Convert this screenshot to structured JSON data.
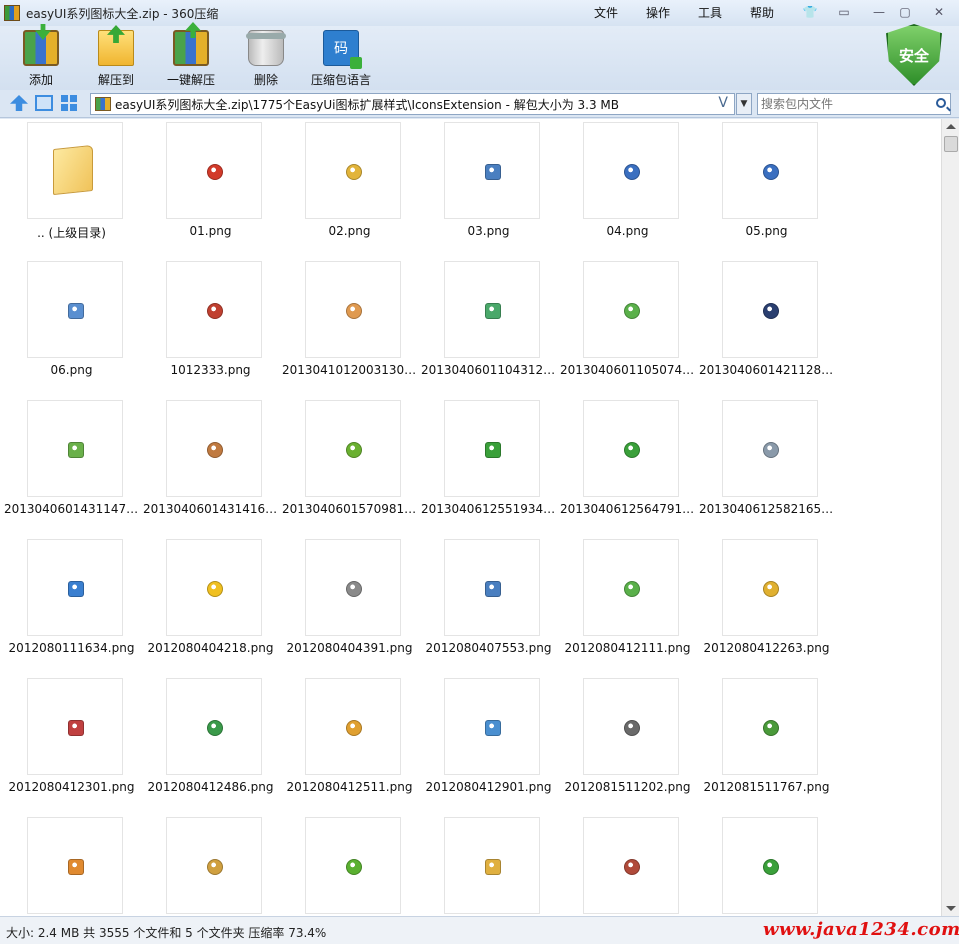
{
  "window": {
    "title": "easyUI系列图标大全.zip - 360压缩",
    "menus": [
      "文件",
      "操作",
      "工具",
      "帮助"
    ]
  },
  "toolbar": {
    "tools": [
      {
        "label": "添加",
        "icon": "add-archive-icon"
      },
      {
        "label": "解压到",
        "icon": "extract-to-icon"
      },
      {
        "label": "一键解压",
        "icon": "one-click-extract-icon"
      },
      {
        "label": "删除",
        "icon": "trash-icon"
      },
      {
        "label": "压缩包语言",
        "icon": "archive-language-icon",
        "glyph": "码"
      }
    ],
    "security_badge": "安全"
  },
  "address": {
    "path": "easyUI系列图标大全.zip\\1775个EasyUi图标扩展样式\\IconsExtension - 解包大小为 3.3 MB",
    "search_placeholder": "搜索包内文件"
  },
  "files": [
    {
      "name": ".. (上级目录)",
      "icon": "parent-folder-icon",
      "color": "#f0c35a"
    },
    {
      "name": "01.png",
      "icon": "red-circle-icon",
      "color": "#d23a2a"
    },
    {
      "name": "02.png",
      "icon": "lock-icon",
      "color": "#e2b43a"
    },
    {
      "name": "03.png",
      "icon": "user-icon",
      "color": "#4a7fc0"
    },
    {
      "name": "04.png",
      "icon": "fit-frame-icon",
      "color": "#3a6fc0"
    },
    {
      "name": "05.png",
      "icon": "fullscreen-icon",
      "color": "#3a6fc0"
    },
    {
      "name": "06.png",
      "icon": "list-icon",
      "color": "#5a8fd0"
    },
    {
      "name": "1012333.png",
      "icon": "tools-icon",
      "color": "#c04030"
    },
    {
      "name": "20130410120031302...",
      "icon": "orange-badge-icon",
      "color": "#e09a50"
    },
    {
      "name": "20130406011043129...",
      "icon": "picture-icon",
      "color": "#4aa86a"
    },
    {
      "name": "20130406011050744...",
      "icon": "doc-ok-icon",
      "color": "#5ab04a"
    },
    {
      "name": "20130406014211289...",
      "icon": "police-icon",
      "color": "#2a3f70"
    },
    {
      "name": "20130406014311476...",
      "icon": "green-refresh-icon",
      "color": "#6ab04a"
    },
    {
      "name": "20130406014314162...",
      "icon": "gear-orange-icon",
      "color": "#c07a40"
    },
    {
      "name": "20130406015709810...",
      "icon": "sync-icon",
      "color": "#6ab030"
    },
    {
      "name": "20130406125519344...",
      "icon": "download-icon",
      "color": "#3aa03a"
    },
    {
      "name": "20130406125647919...",
      "icon": "upload-icon",
      "color": "#3aa03a"
    },
    {
      "name": "20130406125821654...",
      "icon": "doc-arrow-icon",
      "color": "#8a9aaa"
    },
    {
      "name": "2012080111634.png",
      "icon": "network-icon",
      "color": "#3a7fd0"
    },
    {
      "name": "2012080404218.png",
      "icon": "warning-icon",
      "color": "#f0c020"
    },
    {
      "name": "2012080404391.png",
      "icon": "gear-icon",
      "color": "#8a8a8a"
    },
    {
      "name": "2012080407553.png",
      "icon": "window-error-icon",
      "color": "#4a7fc0"
    },
    {
      "name": "2012080412111.png",
      "icon": "recycle-icon",
      "color": "#5ab04a"
    },
    {
      "name": "2012080412263.png",
      "icon": "lock-key-icon",
      "color": "#e0b030"
    },
    {
      "name": "2012080412301.png",
      "icon": "undo-icon",
      "color": "#c04040"
    },
    {
      "name": "2012080412486.png",
      "icon": "excel-icon",
      "color": "#3a9a4a"
    },
    {
      "name": "2012080412511.png",
      "icon": "comment-icon",
      "color": "#e0a030"
    },
    {
      "name": "2012080412901.png",
      "icon": "window-add-icon",
      "color": "#4a8fd0"
    },
    {
      "name": "2012081511202.png",
      "icon": "printer-icon",
      "color": "#6a6a6a"
    },
    {
      "name": "2012081511767.png",
      "icon": "sitemap-icon",
      "color": "#4a9a3a"
    },
    {
      "name": "",
      "icon": "users-icon",
      "color": "#e08a30"
    },
    {
      "name": "",
      "icon": "zoom-icon",
      "color": "#d0a040"
    },
    {
      "name": "",
      "icon": "reload-icon",
      "color": "#5ab030"
    },
    {
      "name": "",
      "icon": "folder-open-icon",
      "color": "#e0b040"
    },
    {
      "name": "",
      "icon": "bin-icon",
      "color": "#b04a3a"
    },
    {
      "name": "",
      "icon": "ok-icon",
      "color": "#3aa03a"
    }
  ],
  "status": {
    "text": "大小: 2.4 MB 共 3555 个文件和 5 个文件夹 压缩率 73.4%",
    "watermark": "www.java1234.com"
  }
}
